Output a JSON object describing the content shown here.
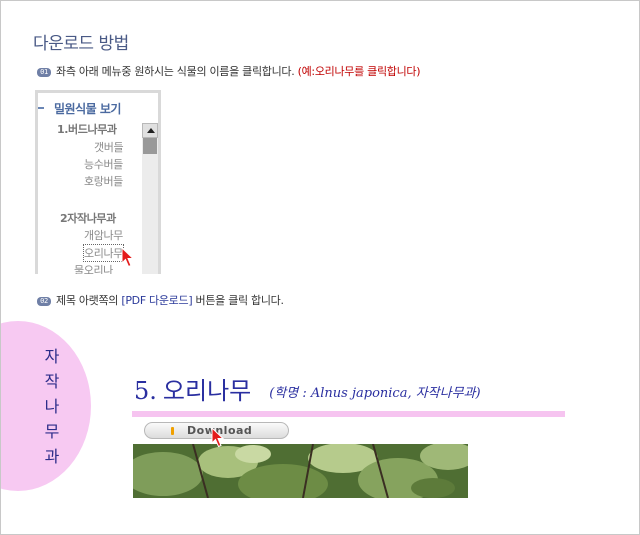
{
  "page": {
    "title": "다운로드 방법"
  },
  "steps": [
    {
      "badge": "01",
      "text": "좌측 아래 메뉴중 원하시는 식물의 이름을 클릭합니다.",
      "highlight": "(예:오리나무를 클릭합니다)"
    },
    {
      "badge": "02",
      "prefix": "제목 아랫쪽의",
      "highlight": "[PDF 다운로드]",
      "suffix": "버튼을 클릭 합니다."
    }
  ],
  "sidebar": {
    "heading": "밀원식물 보기",
    "items": [
      {
        "label": "1.버드나무과",
        "kind": "category"
      },
      {
        "label": "갯버들",
        "kind": "plant"
      },
      {
        "label": "능수버들",
        "kind": "plant"
      },
      {
        "label": "호랑버들",
        "kind": "plant"
      },
      {
        "label": "2자작나무과",
        "kind": "category"
      },
      {
        "label": "개암나무",
        "kind": "plant"
      },
      {
        "label": "오리나무",
        "kind": "plant",
        "selected": true
      },
      {
        "label": "물오리나",
        "kind": "plant"
      }
    ]
  },
  "plant_page": {
    "family_vertical": [
      "자",
      "작",
      "나",
      "무",
      "과"
    ],
    "number": "5.",
    "name": "오리나무",
    "scientific": "(학명 : Alnus japonica, 자작나무과)",
    "download_label": "Download"
  },
  "colors": {
    "accent_blue": "#2a2fa0",
    "highlight_red": "#c00000",
    "pink": "#f6c4f0"
  }
}
